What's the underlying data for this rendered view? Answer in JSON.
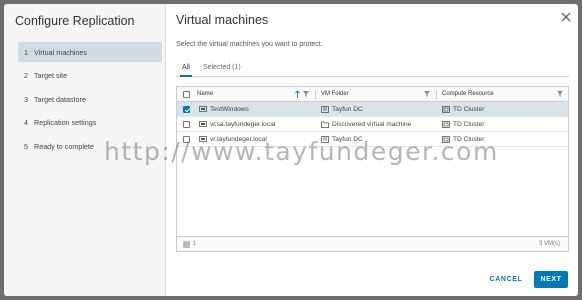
{
  "dialog": {
    "title": "Configure Replication",
    "steps": [
      {
        "num": "1",
        "label": "Virtual machines",
        "active": true
      },
      {
        "num": "2",
        "label": "Target site",
        "active": false
      },
      {
        "num": "3",
        "label": "Target datastore",
        "active": false
      },
      {
        "num": "4",
        "label": "Replication settings",
        "active": false
      },
      {
        "num": "5",
        "label": "Ready to complete",
        "active": false
      }
    ]
  },
  "page": {
    "title": "Virtual machines",
    "subtitle": "Select the virtual machines you want to protect.",
    "tabs": {
      "all": "All",
      "selected": "Selected (1)"
    }
  },
  "table": {
    "columns": {
      "name": "Name",
      "folder": "VM Folder",
      "resource": "Compute Resource"
    },
    "rows": [
      {
        "name": "TestWindows",
        "folder": "Tayfun DC",
        "resource": "TD Cluster",
        "checked": true
      },
      {
        "name": "vcsa.tayfundeger.local",
        "folder": "Discovered virtual machine",
        "resource": "TD Cluster",
        "checked": false
      },
      {
        "name": "vr.tayfundeger.local",
        "folder": "Tayfun DC",
        "resource": "TD Cluster",
        "checked": false
      }
    ],
    "footer": {
      "selected_count": "1",
      "total": "3 VM(s)"
    }
  },
  "buttons": {
    "cancel": "CANCEL",
    "next": "NEXT"
  },
  "watermark": "http://www.tayfundeger.com",
  "colors": {
    "accent": "#0079b8",
    "selected_row": "#d8e3ea",
    "active_step": "#d1dbe4"
  }
}
